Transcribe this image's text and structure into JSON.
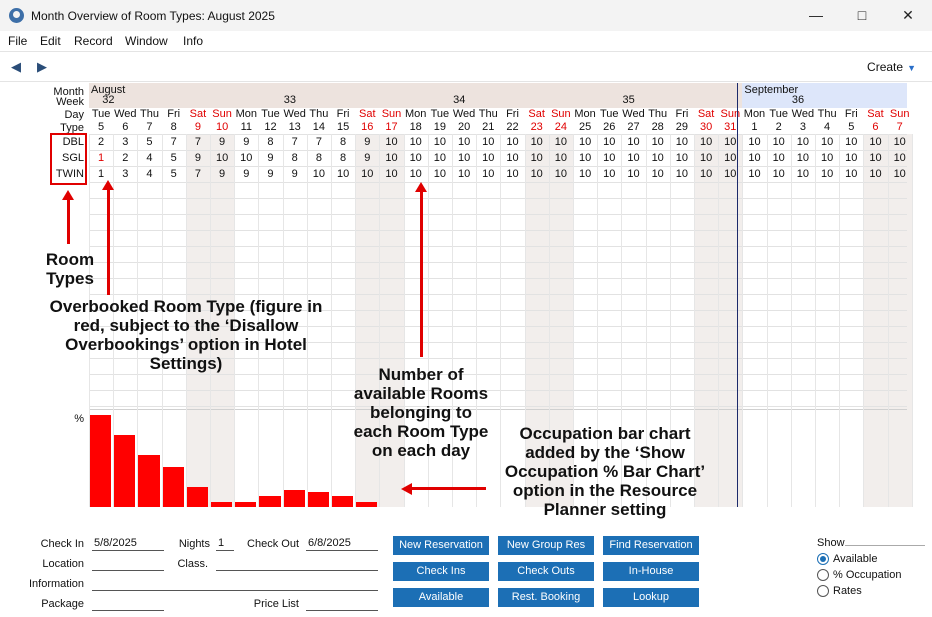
{
  "window": {
    "title": "Month Overview of Room Types: August 2025",
    "minimize_icon": "minimize-icon",
    "maximize_icon": "maximize-icon",
    "close_icon": "close-icon"
  },
  "menu": [
    "File",
    "Edit",
    "Record",
    "Window",
    "Info"
  ],
  "toolbar": {
    "create_label": "Create"
  },
  "grid": {
    "row_labels": {
      "month": "Month",
      "week": "Week",
      "day": "Day",
      "type": "Type"
    },
    "months": [
      {
        "name": "August"
      },
      {
        "name": "September"
      }
    ],
    "weeks": [
      "32",
      "33",
      "34",
      "35",
      "36"
    ],
    "days": [
      {
        "d": "Tue",
        "n": "5"
      },
      {
        "d": "Wed",
        "n": "6"
      },
      {
        "d": "Thu",
        "n": "7"
      },
      {
        "d": "Fri",
        "n": "8"
      },
      {
        "d": "Sat",
        "n": "9"
      },
      {
        "d": "Sun",
        "n": "10"
      },
      {
        "d": "Mon",
        "n": "11"
      },
      {
        "d": "Tue",
        "n": "12"
      },
      {
        "d": "Wed",
        "n": "13"
      },
      {
        "d": "Thu",
        "n": "14"
      },
      {
        "d": "Fri",
        "n": "15"
      },
      {
        "d": "Sat",
        "n": "16"
      },
      {
        "d": "Sun",
        "n": "17"
      },
      {
        "d": "Mon",
        "n": "18"
      },
      {
        "d": "Tue",
        "n": "19"
      },
      {
        "d": "Wed",
        "n": "20"
      },
      {
        "d": "Thu",
        "n": "21"
      },
      {
        "d": "Fri",
        "n": "22"
      },
      {
        "d": "Sat",
        "n": "23"
      },
      {
        "d": "Sun",
        "n": "24"
      },
      {
        "d": "Mon",
        "n": "25"
      },
      {
        "d": "Tue",
        "n": "26"
      },
      {
        "d": "Wed",
        "n": "27"
      },
      {
        "d": "Thu",
        "n": "28"
      },
      {
        "d": "Fri",
        "n": "29"
      },
      {
        "d": "Sat",
        "n": "30"
      },
      {
        "d": "Sun",
        "n": "31"
      },
      {
        "d": "Mon",
        "n": "1"
      },
      {
        "d": "Tue",
        "n": "2"
      },
      {
        "d": "Wed",
        "n": "3"
      },
      {
        "d": "Thu",
        "n": "4"
      },
      {
        "d": "Fri",
        "n": "5"
      },
      {
        "d": "Sat",
        "n": "6"
      },
      {
        "d": "Sun",
        "n": "7"
      }
    ],
    "room_types": [
      {
        "code": "DBL",
        "values": [
          "2",
          "3",
          "5",
          "7",
          "7",
          "9",
          "9",
          "8",
          "7",
          "7",
          "8",
          "9",
          "10",
          "10",
          "10",
          "10",
          "10",
          "10",
          "10",
          "10",
          "10",
          "10",
          "10",
          "10",
          "10",
          "10",
          "10",
          "10",
          "10",
          "10",
          "10",
          "10",
          "10",
          "10"
        ]
      },
      {
        "code": "SGL",
        "values": [
          "1",
          "2",
          "4",
          "5",
          "9",
          "10",
          "10",
          "9",
          "8",
          "8",
          "8",
          "9",
          "10",
          "10",
          "10",
          "10",
          "10",
          "10",
          "10",
          "10",
          "10",
          "10",
          "10",
          "10",
          "10",
          "10",
          "10",
          "10",
          "10",
          "10",
          "10",
          "10",
          "10",
          "10"
        ],
        "overbooked": [
          0
        ]
      },
      {
        "code": "TWIN",
        "values": [
          "1",
          "3",
          "4",
          "5",
          "7",
          "9",
          "9",
          "9",
          "9",
          "10",
          "10",
          "10",
          "10",
          "10",
          "10",
          "10",
          "10",
          "10",
          "10",
          "10",
          "10",
          "10",
          "10",
          "10",
          "10",
          "10",
          "10",
          "10",
          "10",
          "10",
          "10",
          "10",
          "10",
          "10"
        ]
      }
    ],
    "accent_red": "#e00000"
  },
  "chart_data": {
    "type": "bar",
    "ylabel": "%",
    "values": [
      100,
      78,
      57,
      43,
      22,
      5,
      5,
      12,
      19,
      16,
      12,
      5
    ]
  },
  "annotations": {
    "room_types": "Room\nTypes",
    "overbooked": "Overbooked Room Type (figure in\nred, subject to the ‘Disallow\nOverbookings’ option in Hotel\nSettings)",
    "available": "Number of\navailable Rooms\nbelonging to\neach Room Type\non each day",
    "occupation": "Occupation bar chart\nadded by the ‘Show\nOccupation % Bar Chart’\noption in the Resource\nPlanner setting"
  },
  "footer": {
    "check_in_label": "Check In",
    "check_in": "5/8/2025",
    "nights_label": "Nights",
    "nights": "1",
    "check_out_label": "Check Out",
    "check_out": "6/8/2025",
    "location_label": "Location",
    "class_label": "Class.",
    "information_label": "Information",
    "package_label": "Package",
    "price_list_label": "Price List",
    "buttons": [
      "New Reservation",
      "New Group Res",
      "Find Reservation",
      "Check Ins",
      "Check Outs",
      "In-House",
      "Available",
      "Rest. Booking",
      "Lookup"
    ],
    "show_label": "Show",
    "show_options": [
      "Available",
      "% Occupation",
      "Rates"
    ],
    "button_color": "#1c6fb5"
  }
}
